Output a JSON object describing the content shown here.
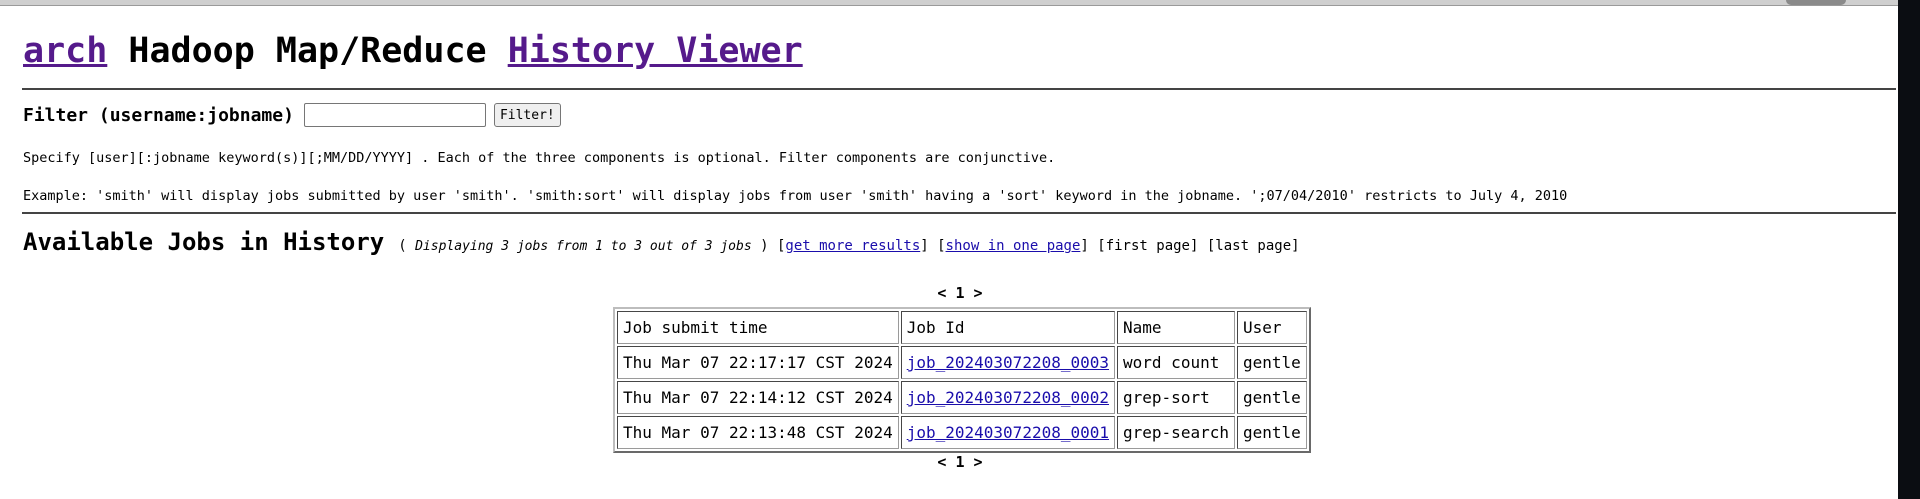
{
  "header": {
    "link_left": "arch",
    "middle": "Hadoop Map/Reduce",
    "link_right": "History Viewer"
  },
  "filter": {
    "label": "Filter (username:jobname)",
    "input_value": "",
    "button_label": "Filter!"
  },
  "help": {
    "line1": "Specify [user][:jobname keyword(s)][;MM/DD/YYYY] . Each of the three components is optional. Filter components are conjunctive.",
    "line2": "Example: 'smith' will display jobs submitted by user 'smith'. 'smith:sort' will display jobs from user 'smith' having a 'sort' keyword in the jobname. ';07/04/2010' restricts to July 4, 2010"
  },
  "available": {
    "title": "Available Jobs in History",
    "open_paren": "(",
    "displaying": "Displaying 3 jobs from 1 to 3 out of 3 jobs",
    "close_paren": ")",
    "more_results": "get more results",
    "one_page": "show in one page",
    "first_page": "[first page]",
    "last_page": "[last page]"
  },
  "pager": {
    "prev": "<",
    "page": "1",
    "next": ">"
  },
  "table": {
    "headers": [
      "Job submit time",
      "Job Id",
      "Name",
      "User"
    ],
    "rows": [
      [
        "Thu Mar 07 22:17:17 CST 2024",
        "job_202403072208_0003",
        "word count",
        "gentle"
      ],
      [
        "Thu Mar 07 22:14:12 CST 2024",
        "job_202403072208_0002",
        "grep-sort",
        "gentle"
      ],
      [
        "Thu Mar 07 22:13:48 CST 2024",
        "job_202403072208_0001",
        "grep-search",
        "gentle"
      ]
    ]
  },
  "colors": {
    "link": "#1a0dab",
    "visited_link": "#551a8b",
    "rule": "#444444"
  }
}
